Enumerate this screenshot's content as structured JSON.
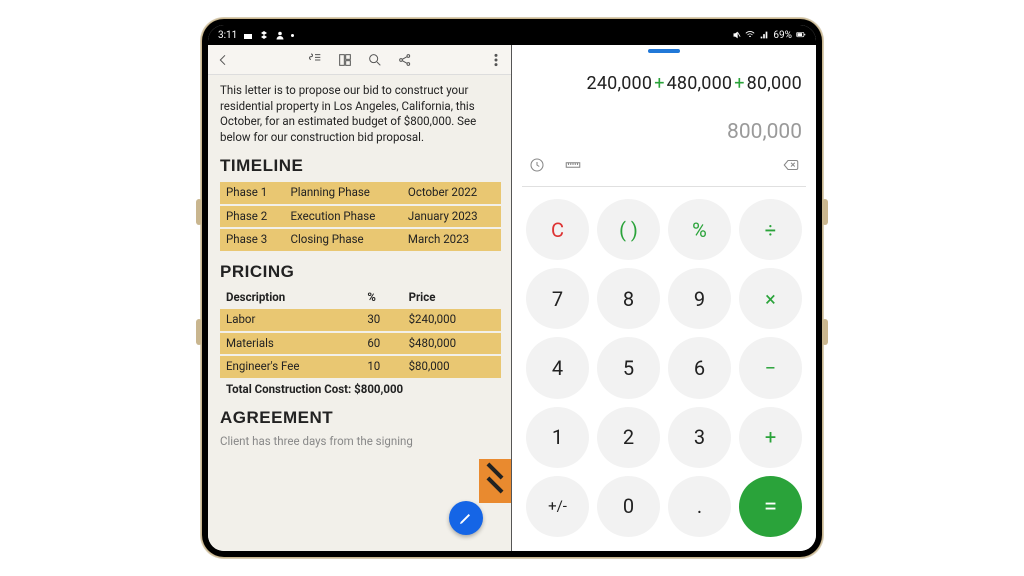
{
  "statusbar": {
    "time": "3:11",
    "battery_pct": "69%"
  },
  "document": {
    "intro_text": "This letter is to propose our bid to construct your residential property in Los Angeles, California, this October, for an estimated budget of $800,000. See below for our construction bid proposal.",
    "timeline_heading": "TIMELINE",
    "timeline": {
      "rows": [
        {
          "phase": "Phase 1",
          "name": "Planning Phase",
          "date": "October 2022"
        },
        {
          "phase": "Phase 2",
          "name": "Execution Phase",
          "date": "January 2023"
        },
        {
          "phase": "Phase 3",
          "name": "Closing Phase",
          "date": "March 2023"
        }
      ]
    },
    "pricing_heading": "PRICING",
    "pricing": {
      "headers": {
        "desc": "Description",
        "pct": "%",
        "price": "Price"
      },
      "rows": [
        {
          "desc": "Labor",
          "pct": "30",
          "price": "$240,000"
        },
        {
          "desc": "Materials",
          "pct": "60",
          "price": "$480,000"
        },
        {
          "desc": "Engineer's Fee",
          "pct": "10",
          "price": "$80,000"
        }
      ],
      "total_label": "Total Construction Cost: $800,000"
    },
    "agreement_heading": "AGREEMENT",
    "agreement_preview": "Client has three days from the signing"
  },
  "calculator": {
    "expr": {
      "a": "240,000",
      "op1": "+",
      "b": "480,000",
      "op2": "+",
      "c": "80,000"
    },
    "result": "800,000",
    "keys": {
      "clear": "C",
      "paren": "( )",
      "pct": "%",
      "div": "÷",
      "k7": "7",
      "k8": "8",
      "k9": "9",
      "mul": "×",
      "k4": "4",
      "k5": "5",
      "k6": "6",
      "sub": "−",
      "k1": "1",
      "k2": "2",
      "k3": "3",
      "add": "+",
      "sign": "+/-",
      "k0": "0",
      "dot": ".",
      "eq": "="
    }
  }
}
